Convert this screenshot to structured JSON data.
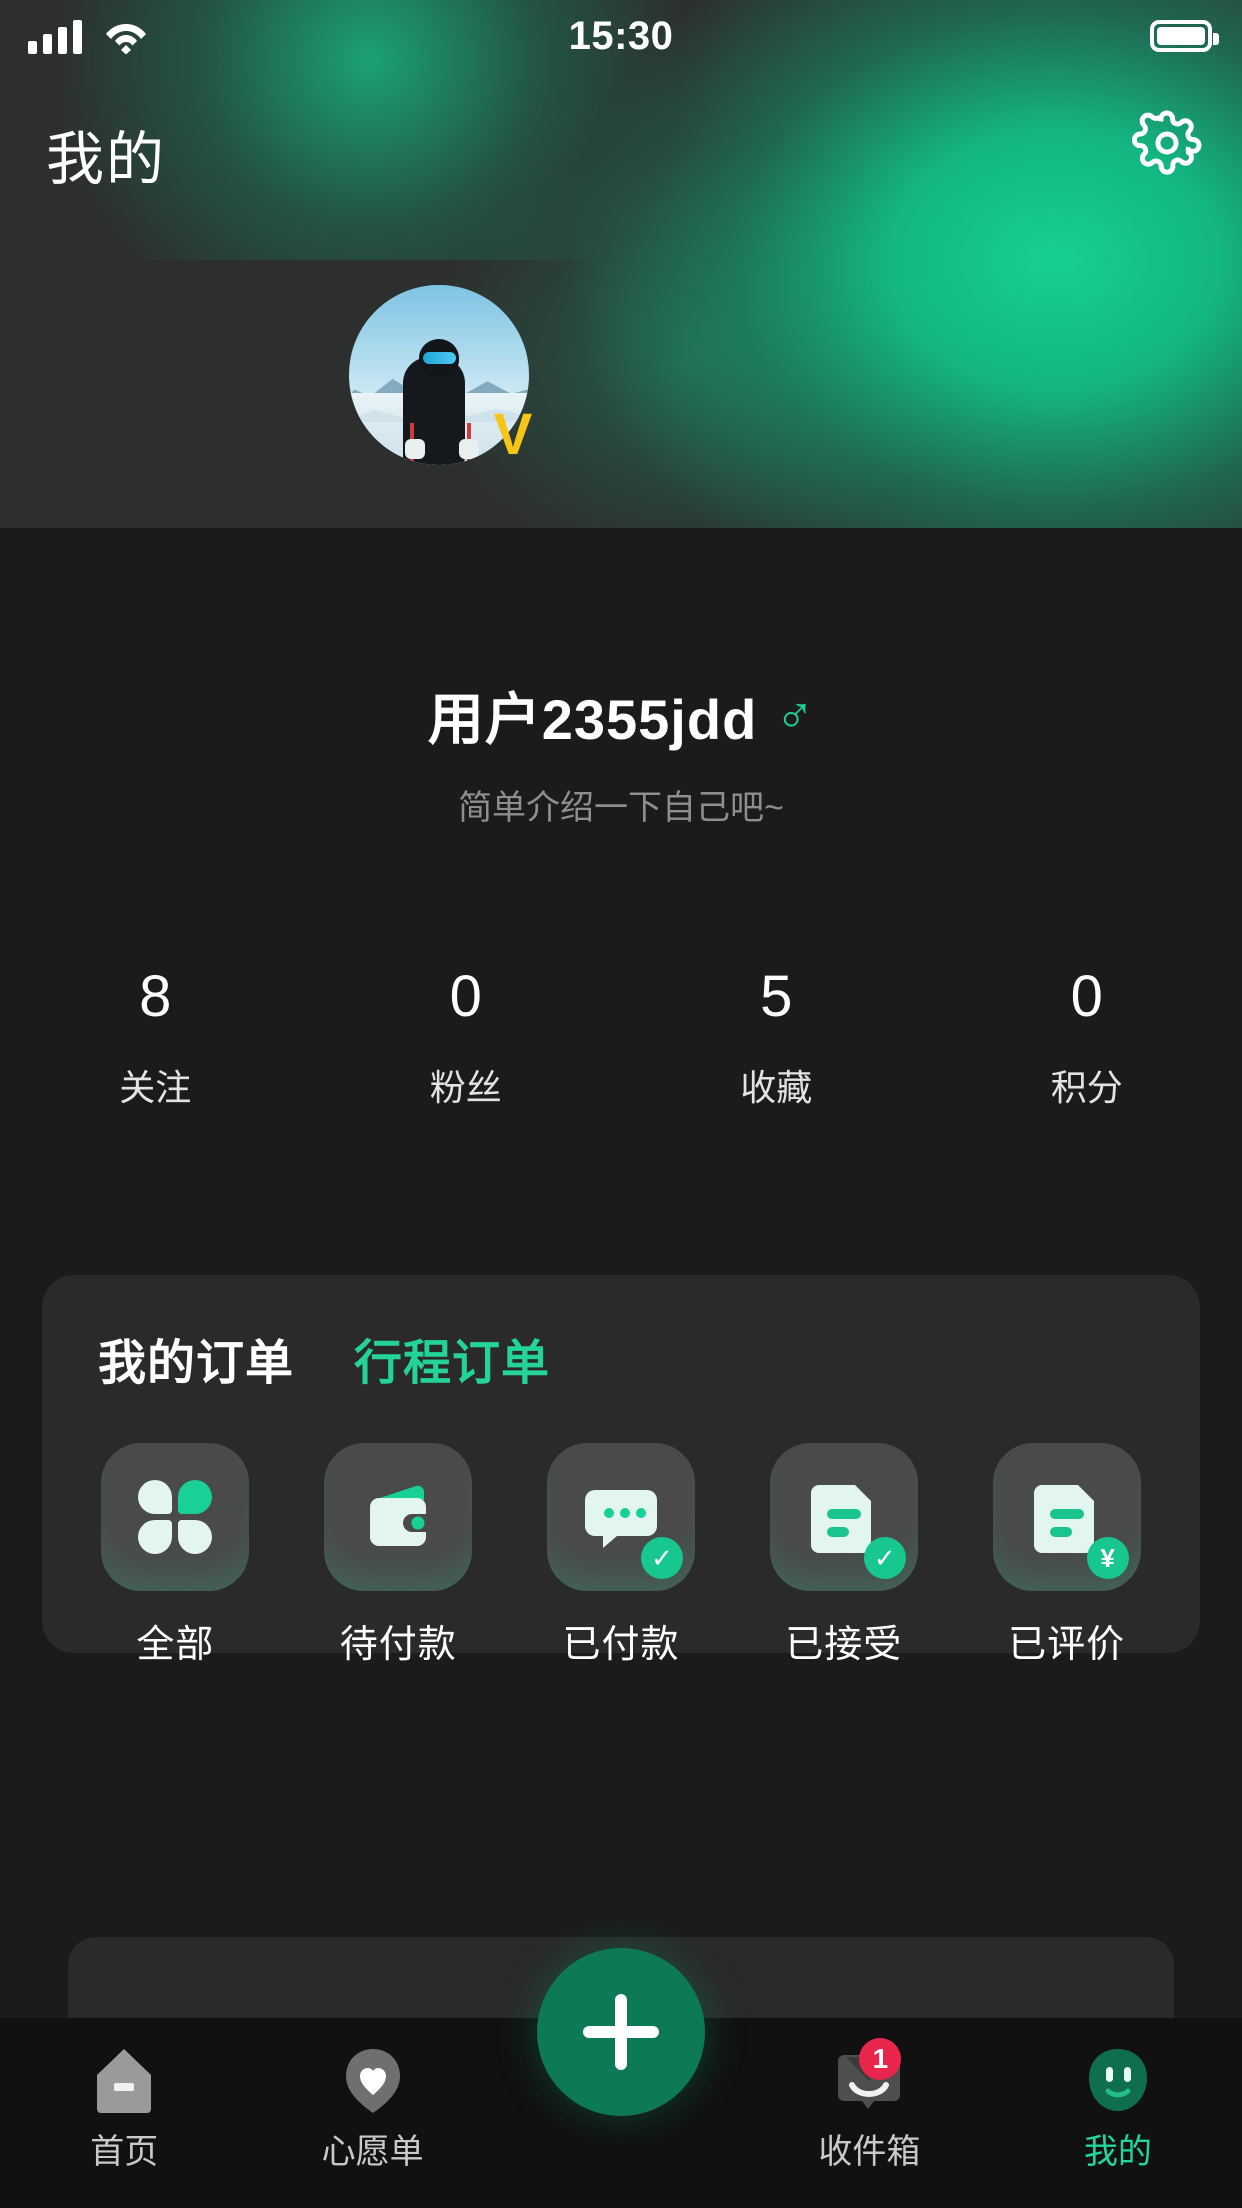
{
  "statusbar": {
    "time": "15:30",
    "signal_icon": "signal-bars-icon",
    "wifi_icon": "wifi-icon",
    "battery_icon": "battery-full-icon"
  },
  "header": {
    "title": "我的",
    "settings_icon": "gear-icon"
  },
  "profile": {
    "avatar_alt": "skier-avatar",
    "verified_badge": "V",
    "username": "用户2355jdd",
    "gender_symbol": "♂",
    "bio_placeholder": "简单介绍一下自己吧~"
  },
  "stats": [
    {
      "value": "8",
      "label": "关注"
    },
    {
      "value": "0",
      "label": "粉丝"
    },
    {
      "value": "5",
      "label": "收藏"
    },
    {
      "value": "0",
      "label": "积分"
    }
  ],
  "orders": {
    "tabs": [
      {
        "label": "我的订单",
        "active": true
      },
      {
        "label": "行程订单",
        "active": false
      }
    ],
    "items": [
      {
        "label": "全部",
        "icon": "clover-grid-icon",
        "badge": ""
      },
      {
        "label": "待付款",
        "icon": "wallet-icon",
        "badge": ""
      },
      {
        "label": "已付款",
        "icon": "chat-bubble-check-icon",
        "badge": "✓"
      },
      {
        "label": "已接受",
        "icon": "document-check-icon",
        "badge": "✓"
      },
      {
        "label": "已评价",
        "icon": "document-yuan-icon",
        "badge": "¥"
      }
    ]
  },
  "tabbar": {
    "items": [
      {
        "label": "首页",
        "icon": "home-icon",
        "active": false,
        "badge": ""
      },
      {
        "label": "心愿单",
        "icon": "heart-icon",
        "active": false,
        "badge": ""
      },
      {
        "label": "收件箱",
        "icon": "inbox-icon",
        "active": false,
        "badge": "1"
      },
      {
        "label": "我的",
        "icon": "smiley-icon",
        "active": true,
        "badge": ""
      }
    ],
    "fab_icon": "plus-icon"
  },
  "colors": {
    "accent_green": "#21d69c",
    "hero_glow": "#16cf92",
    "fab_green": "#0e7a55",
    "badge_red": "#e8254b",
    "verify_yellow": "#F5C518",
    "sheet_bg": "#1b1b1b",
    "card_bg": "#2a2a2a"
  }
}
